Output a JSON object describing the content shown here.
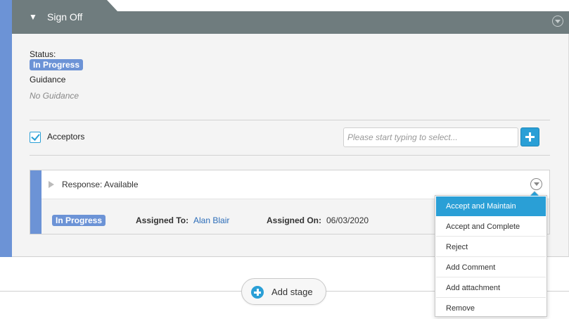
{
  "stage": {
    "title": "Sign Off",
    "collapse_glyph": "▼",
    "menu_icon": "chevron-down-circle-icon",
    "status_label": "Status:",
    "status_value": "In Progress",
    "guidance_label": "Guidance",
    "guidance_value": "No Guidance"
  },
  "acceptors": {
    "label": "Acceptors",
    "checked": true,
    "placeholder": "Please start typing to select...",
    "add_icon": "plus-icon"
  },
  "response": {
    "title": "Response: Available",
    "status": "In Progress",
    "assigned_to_label": "Assigned To:",
    "assigned_to_value": "Alan Blair",
    "assigned_on_label": "Assigned On:",
    "assigned_on_value": "06/03/2020"
  },
  "dropdown": {
    "items": [
      {
        "label": "Accept and Maintain",
        "active": true
      },
      {
        "label": "Accept and Complete",
        "active": false
      },
      {
        "label": "Reject",
        "active": false
      },
      {
        "label": "Add Comment",
        "active": false
      },
      {
        "label": "Add attachment",
        "active": false
      },
      {
        "label": "Remove",
        "active": false
      }
    ]
  },
  "add_stage": {
    "label": "Add stage"
  },
  "colors": {
    "accent_blue": "#2a9fd6",
    "stage_blue": "#6c93d6",
    "header_gray": "#6f7c7e",
    "link_blue": "#2b6cb8"
  }
}
